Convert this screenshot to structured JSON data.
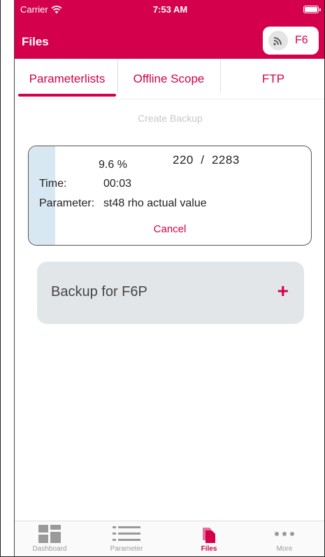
{
  "status_bar": {
    "carrier": "Carrier",
    "time": "7:53 AM"
  },
  "header": {
    "title": "Files",
    "device": "F6"
  },
  "tabs": [
    {
      "label": "Parameterlists",
      "active": true
    },
    {
      "label": "Offline Scope",
      "active": false
    },
    {
      "label": "FTP",
      "active": false
    }
  ],
  "create_backup_label": "Create Backup",
  "progress": {
    "percent_text": "9.6 %",
    "count_text": "220  /  2283",
    "fraction": 0.096,
    "time_label": "Time:",
    "time_value": "00:03",
    "parameter_label": "Parameter:",
    "parameter_value": "st48 rho actual value",
    "cancel_label": "Cancel"
  },
  "backup_item": {
    "label": "Backup for F6P"
  },
  "tabbar": [
    {
      "label": "Dashboard",
      "icon": "dashboard-icon",
      "active": false
    },
    {
      "label": "Parameter",
      "icon": "list-icon",
      "active": false
    },
    {
      "label": "Files",
      "icon": "files-icon",
      "active": true
    },
    {
      "label": "More",
      "icon": "more-icon",
      "active": false
    }
  ],
  "colors": {
    "accent": "#d4004b",
    "progress_fill": "#d8e8f3",
    "card_bg": "#e3e6e8"
  }
}
